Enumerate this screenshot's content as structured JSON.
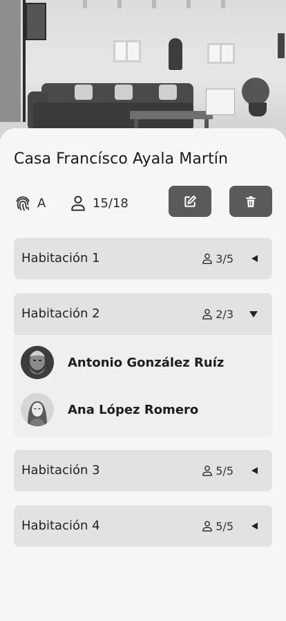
{
  "house": {
    "title": "Casa Francísco Ayala Martín",
    "access_level": "A",
    "occupancy": "15/18"
  },
  "actions": {
    "edit_icon": "edit-icon",
    "delete_icon": "trash-icon"
  },
  "rooms": [
    {
      "name": "Habitación 1",
      "occupancy": "3/5",
      "expanded": false
    },
    {
      "name": "Habitación 2",
      "occupancy": "2/3",
      "expanded": true,
      "residents": [
        {
          "name": "Antonio González Ruíz"
        },
        {
          "name": "Ana López Romero"
        }
      ]
    },
    {
      "name": "Habitación 3",
      "occupancy": "5/5",
      "expanded": false
    },
    {
      "name": "Habitación 4",
      "occupancy": "5/5",
      "expanded": false
    }
  ],
  "colors": {
    "button_bg": "#5a5a5a",
    "room_bg": "#e2e2e2",
    "expanded_body_bg": "#efefef",
    "page_bg": "#f6f6f6"
  }
}
